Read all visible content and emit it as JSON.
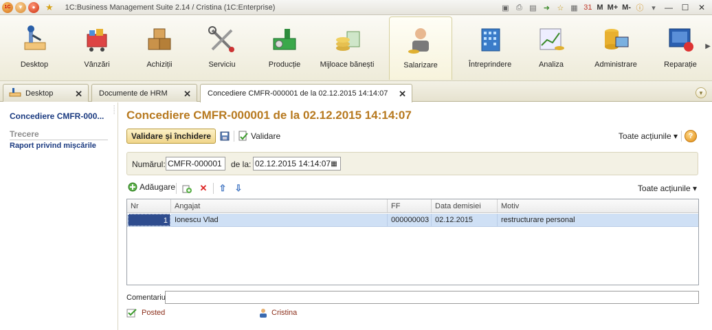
{
  "window": {
    "title": "1C:Business Management Suite 2.14 / Cristina  (1C:Enterprise)",
    "logo_text": "1C",
    "memory_buttons": [
      "M",
      "M+",
      "M-"
    ]
  },
  "sections": [
    {
      "label": "Desktop",
      "icon": "desktop-icon"
    },
    {
      "label": "Vânzări",
      "icon": "sales-cart-icon"
    },
    {
      "label": "Achiziții",
      "icon": "purchases-boxes-icon"
    },
    {
      "label": "Serviciu",
      "icon": "service-tools-icon"
    },
    {
      "label": "Producție",
      "icon": "production-icon"
    },
    {
      "label": "Mijloace bănești",
      "icon": "money-coins-icon"
    },
    {
      "label": "Salarizare",
      "icon": "payroll-person-icon",
      "active": true
    },
    {
      "label": "Întreprindere",
      "icon": "enterprise-building-icon"
    },
    {
      "label": "Analiza",
      "icon": "analysis-chart-icon"
    },
    {
      "label": "Administrare",
      "icon": "administration-icon"
    },
    {
      "label": "Reparație",
      "icon": "repair-icon"
    }
  ],
  "tabs": [
    {
      "label": "Desktop"
    },
    {
      "label": "Documente de HRM"
    },
    {
      "label": "Concediere CMFR-000001 de la 02.12.2015 14:14:07",
      "active": true
    }
  ],
  "leftnav": {
    "current": "Concediere CMFR-000...",
    "group": "Trecere",
    "link": "Raport privind mișcările"
  },
  "form": {
    "title": "Concediere CMFR-000001 de la 02.12.2015 14:14:07",
    "post_close_label": "Validare și închidere",
    "validate_label": "Validare",
    "all_actions_label": "Toate acțiunile ▾",
    "help_label": "?",
    "number_label": "Numărul:",
    "number_value": "CMFR-000001",
    "date_label": "de la:",
    "date_value": "02.12.2015 14:14:07",
    "add_label": "Adăugare",
    "table_all_actions_label": "Toate acțiunile ▾",
    "comment_label": "Comentariu:",
    "comment_value": "",
    "status": "Posted",
    "author": "Cristina"
  },
  "table": {
    "columns": [
      "Nr",
      "Angajat",
      "FF",
      "Data demisiei",
      "Motiv"
    ],
    "rows": [
      {
        "nr": "1",
        "employee": "Ionescu Vlad",
        "ff": "000000003",
        "date": "02.12.2015",
        "reason": "restructurare personal"
      }
    ]
  },
  "colors": {
    "title": "#b7791f",
    "nav_link": "#1a3a80",
    "selected_row": "#cfe0f5",
    "status_text": "#8b2e1a"
  }
}
